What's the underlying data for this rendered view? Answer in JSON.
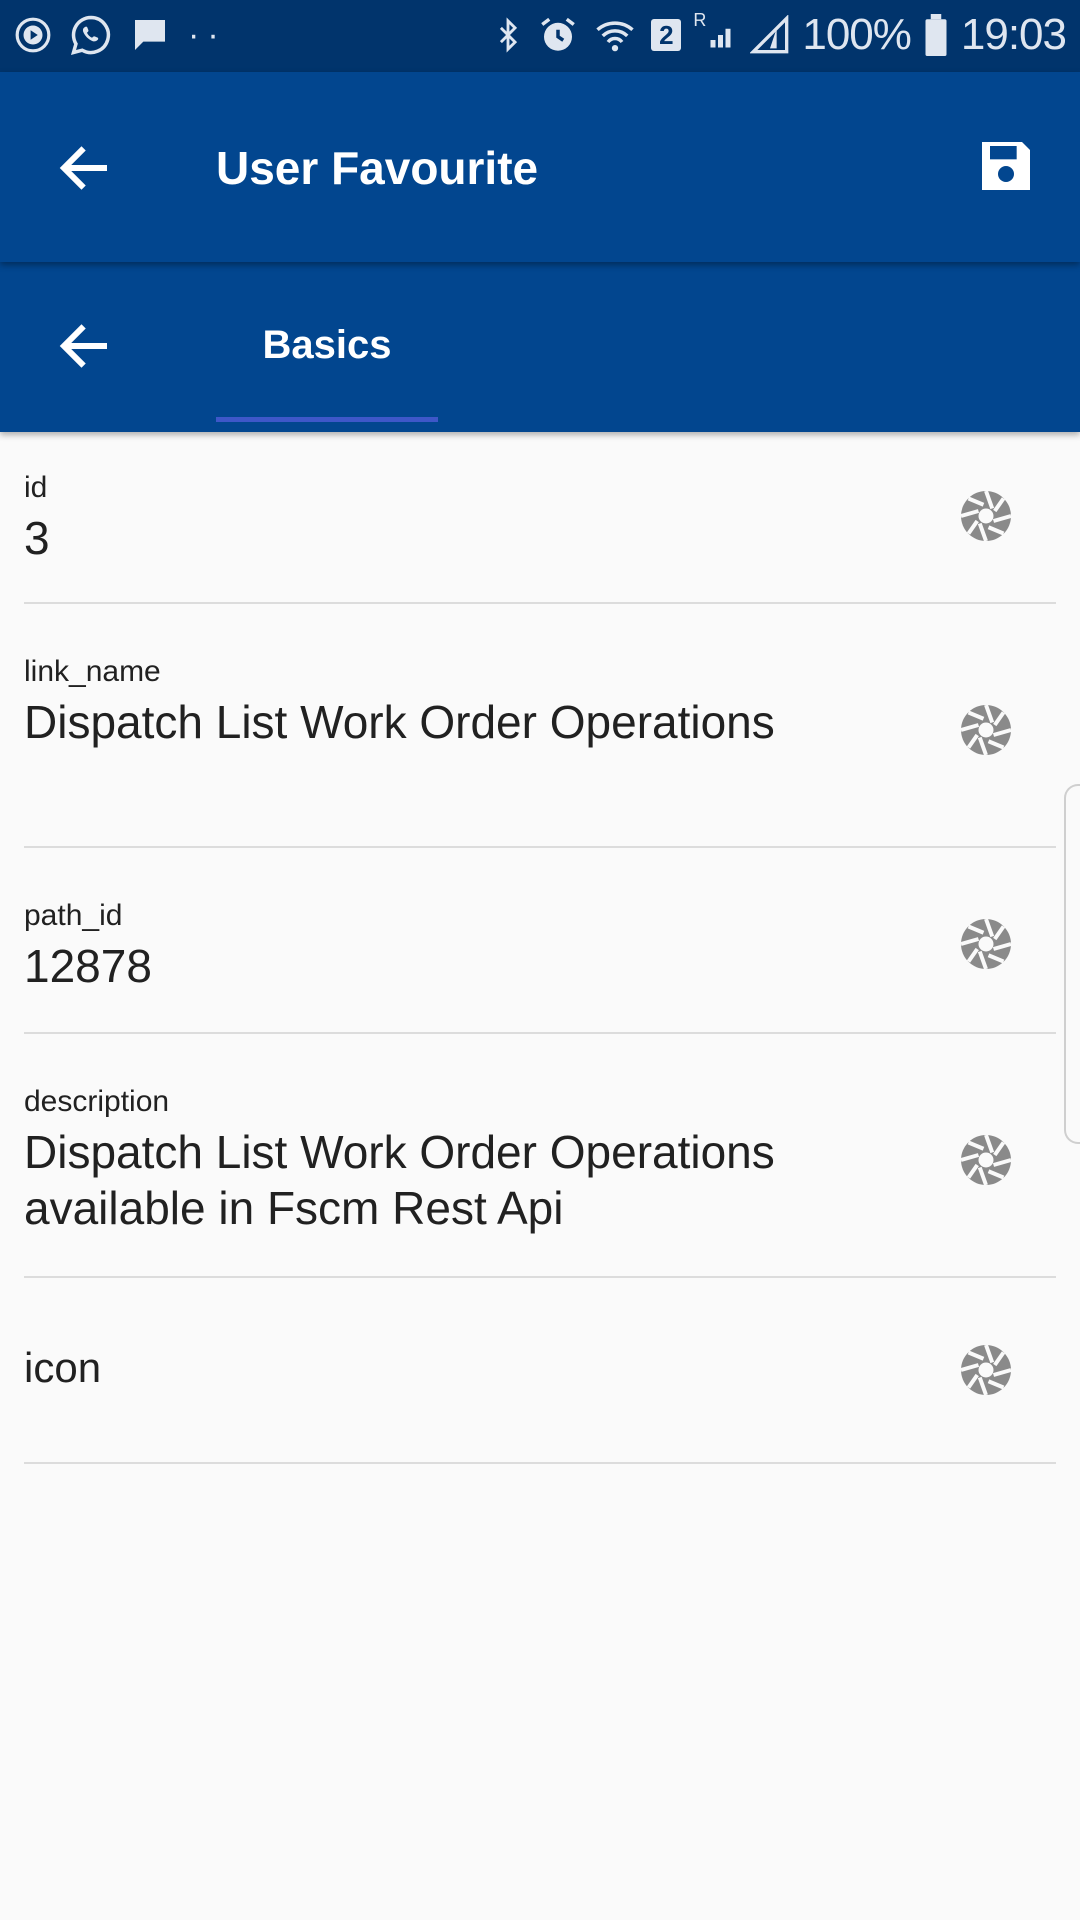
{
  "status_bar": {
    "battery": "100%",
    "time": "19:03",
    "sim_badge": "2",
    "roaming": "R",
    "dots": "··"
  },
  "app_bar": {
    "title": "User Favourite"
  },
  "tabs": [
    {
      "label": "Basics",
      "active": true
    }
  ],
  "fields": [
    {
      "label": "id",
      "value": "3"
    },
    {
      "label": "link_name",
      "value": "Dispatch List Work Order Operations"
    },
    {
      "label": "path_id",
      "value": "12878"
    },
    {
      "label": "description",
      "value": "Dispatch List Work Order Operations available in Fscm Rest Api"
    },
    {
      "label": "",
      "value": "icon"
    }
  ],
  "colors": {
    "status_bar": "#01346c",
    "app_bar": "#02468f",
    "tab_indicator": "#3e57c8",
    "background": "#fafafa",
    "field_icon": "#8a8a8a"
  },
  "icons": {
    "back": "arrow-left-icon",
    "save": "floppy-disk-icon",
    "field_action": "camera-aperture-icon"
  }
}
